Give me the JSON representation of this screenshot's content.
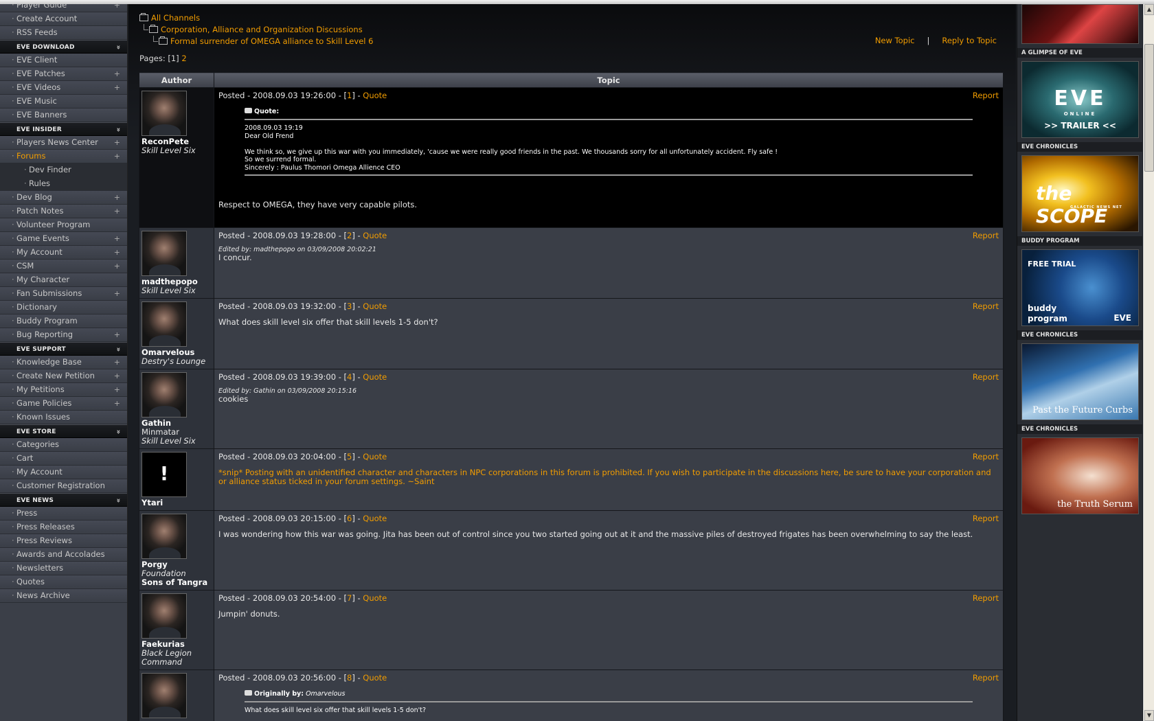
{
  "sidebar": {
    "sections": [
      {
        "heading": null,
        "items": [
          {
            "label": "Player Guide",
            "plus": true
          },
          {
            "label": "Create Account",
            "plus": false
          },
          {
            "label": "RSS Feeds",
            "plus": false
          }
        ]
      },
      {
        "heading": "EVE DOWNLOAD",
        "items": [
          {
            "label": "EVE Client",
            "plus": false
          },
          {
            "label": "EVE Patches",
            "plus": true
          },
          {
            "label": "EVE Videos",
            "plus": true
          },
          {
            "label": "EVE Music",
            "plus": false
          },
          {
            "label": "EVE Banners",
            "plus": false
          }
        ]
      },
      {
        "heading": "EVE INSIDER",
        "items": [
          {
            "label": "Players News Center",
            "plus": true
          },
          {
            "label": "Forums",
            "plus": true,
            "active": true
          },
          {
            "label": "Dev Finder",
            "sub": true
          },
          {
            "label": "Rules",
            "sub": true
          },
          {
            "label": "Dev Blog",
            "plus": true
          },
          {
            "label": "Patch Notes",
            "plus": true
          },
          {
            "label": "Volunteer Program",
            "plus": false
          },
          {
            "label": "Game Events",
            "plus": true
          },
          {
            "label": "My Account",
            "plus": true
          },
          {
            "label": "CSM",
            "plus": true
          },
          {
            "label": "My Character",
            "plus": false
          },
          {
            "label": "Fan Submissions",
            "plus": true
          },
          {
            "label": "Dictionary",
            "plus": false
          },
          {
            "label": "Buddy Program",
            "plus": false
          },
          {
            "label": "Bug Reporting",
            "plus": true
          }
        ]
      },
      {
        "heading": "EVE SUPPORT",
        "items": [
          {
            "label": "Knowledge Base",
            "plus": true
          },
          {
            "label": "Create New Petition",
            "plus": true
          },
          {
            "label": "My Petitions",
            "plus": true
          },
          {
            "label": "Game Policies",
            "plus": true
          },
          {
            "label": "Known Issues",
            "plus": false
          }
        ]
      },
      {
        "heading": "EVE STORE",
        "items": [
          {
            "label": "Categories",
            "plus": false
          },
          {
            "label": "Cart",
            "plus": false
          },
          {
            "label": "My Account",
            "plus": false
          },
          {
            "label": "Customer Registration",
            "plus": false
          }
        ]
      },
      {
        "heading": "EVE NEWS",
        "items": [
          {
            "label": "Press",
            "plus": false
          },
          {
            "label": "Press Releases",
            "plus": false
          },
          {
            "label": "Press Reviews",
            "plus": false
          },
          {
            "label": "Awards and Accolades",
            "plus": false
          },
          {
            "label": "Newsletters",
            "plus": false
          },
          {
            "label": "Quotes",
            "plus": false
          },
          {
            "label": "News Archive",
            "plus": false
          }
        ]
      }
    ]
  },
  "breadcrumb": {
    "level1": "All Channels",
    "level2": "Corporation, Alliance and Organization Discussions",
    "level3": "Formal surrender of OMEGA alliance to Skill Level 6"
  },
  "topic_actions": {
    "new_topic": "New Topic",
    "separator": "|",
    "reply": "Reply to Topic"
  },
  "pages": {
    "label": "Pages:",
    "current": "[1]",
    "next": "2"
  },
  "table_headers": {
    "author": "Author",
    "topic": "Topic"
  },
  "post_labels": {
    "posted": "Posted - ",
    "quote": "Quote",
    "report": "Report"
  },
  "posts": [
    {
      "dark": true,
      "author": "ReconPete",
      "lines": [
        {
          "text": "Skill Level Six",
          "style": "italic"
        }
      ],
      "date": "2008.09.03 19:26:00",
      "num": "1",
      "quote": {
        "title": "Quote:",
        "lines": [
          "2008.09.03 19:19",
          "Dear Old Frend",
          "",
          "We think so, we give up this war with you immediately, 'cause we were really good friends in the past. We thousands sorry for all unfortunately accident. Fly safe !",
          "So we surrend formal.",
          "Sincerely : Paulus Thomori Omega Allience CEO"
        ]
      },
      "text": "Respect to OMEGA, they have very capable pilots."
    },
    {
      "author": "madthepopo",
      "lines": [
        {
          "text": "Skill Level Six",
          "style": "italic"
        }
      ],
      "date": "2008.09.03 19:28:00",
      "num": "2",
      "edited": "Edited by: madthepopo on 03/09/2008 20:02:21",
      "text": "I concur."
    },
    {
      "author": "Omarvelous",
      "lines": [
        {
          "text": "Destry's Lounge",
          "style": "italic"
        }
      ],
      "date": "2008.09.03 19:32:00",
      "num": "3",
      "text": "What does skill level six offer that skill levels 1-5 don't?"
    },
    {
      "author": "Gathin",
      "lines": [
        {
          "text": "Minmatar",
          "style": "plain"
        },
        {
          "text": "Skill Level Six",
          "style": "italic"
        }
      ],
      "date": "2008.09.03 19:39:00",
      "num": "4",
      "edited": "Edited by: Gathin on 03/09/2008 20:15:16",
      "text": "cookies"
    },
    {
      "author": "Ytari",
      "lines": [],
      "blank_avatar": true,
      "date": "2008.09.03 20:04:00",
      "num": "5",
      "mod_text": "*snip* Posting with an unidentified character and characters in NPC corporations in this forum is prohibited. If you wish to participate in the discussions here, be sure to have your corporation and or alliance status ticked in your forum settings. ~Saint"
    },
    {
      "author": "Porgy",
      "lines": [
        {
          "text": "Foundation",
          "style": "italic"
        },
        {
          "text": "Sons of Tangra",
          "style": "bold"
        }
      ],
      "date": "2008.09.03 20:15:00",
      "num": "6",
      "text": "I was wondering how this war was going. Jita has been out of control since you two started going out at it and the massive piles of destroyed frigates has been overwhelming to say the least."
    },
    {
      "author": "Faekurias",
      "lines": [
        {
          "text": "Black Legion",
          "style": "italic"
        },
        {
          "text": "Command",
          "style": "italic"
        }
      ],
      "date": "2008.09.03 20:54:00",
      "num": "7",
      "text": "Jumpin' donuts."
    },
    {
      "author": "",
      "lines": [],
      "date": "2008.09.03 20:56:00",
      "num": "8",
      "quote": {
        "title": "Originally by:",
        "title_author": "Omarvelous",
        "lines": [
          "What does skill level six offer that skill levels 1-5 don't?"
        ]
      }
    }
  ],
  "right_column": {
    "banners": [
      {
        "title": "",
        "kind": "top",
        "text": ""
      },
      {
        "title": "A GLIMPSE OF EVE",
        "kind": "trailer",
        "text": "EVE",
        "sub": "ONLINE",
        "sub2": ">> TRAILER <<"
      },
      {
        "title": "EVE CHRONICLES",
        "kind": "scope",
        "text": "the SCOPE",
        "sub": "GALACTIC NEWS NET"
      },
      {
        "title": "BUDDY PROGRAM",
        "kind": "buddy",
        "text": "FREE TRIAL",
        "sub": "buddy program",
        "sub2": "EVE"
      },
      {
        "title": "EVE CHRONICLES",
        "kind": "chron1",
        "text": "Past the Future Curbs"
      },
      {
        "title": "EVE CHRONICLES",
        "kind": "chron2",
        "text": "the Truth Serum"
      }
    ]
  },
  "icons": {
    "plus": "+",
    "chevron": "»",
    "folder": "folder-icon",
    "quote": "quote-icon"
  },
  "colors": {
    "accent": "#f29d00",
    "sidebar_bg": "#3b3f48",
    "post_bg": "#3a3e47",
    "header_dark": "#101214"
  }
}
